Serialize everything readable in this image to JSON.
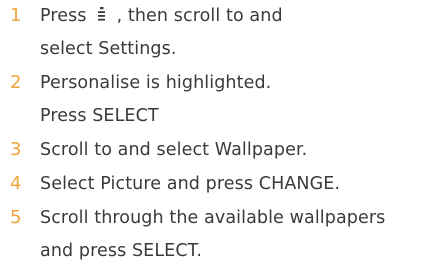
{
  "steps": [
    {
      "number": "1",
      "line1_before_icon": "Press",
      "line1_icon": "menu-key-icon",
      "line1_after_icon": ", then scroll to and",
      "line2": "select Settings."
    },
    {
      "number": "2",
      "line1": "Personalise is highlighted.",
      "line2": "Press SELECT"
    },
    {
      "number": "3",
      "line1": "Scroll to and select Wallpaper."
    },
    {
      "number": "4",
      "line1": "Select Picture and press CHANGE."
    },
    {
      "number": "5",
      "line1": "Scroll through the available wallpapers",
      "line2": "and press SELECT."
    }
  ],
  "colors": {
    "step_number": "#f0a33c",
    "text": "#3a3a3a",
    "background": "#ffffff"
  }
}
